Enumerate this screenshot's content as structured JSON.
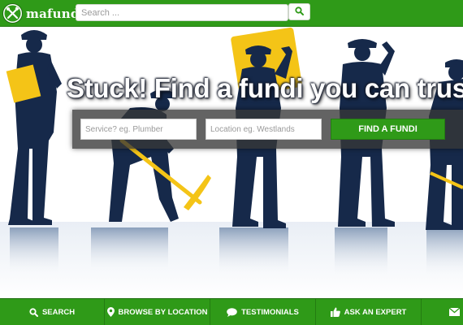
{
  "header": {
    "logo_text": "mafundi",
    "logo_icon": "crossed-tools-icon",
    "search_placeholder": "Search ...",
    "search_button_icon": "search-icon"
  },
  "hero": {
    "headline": "Stuck! Find a fundi you can trust",
    "service_placeholder": "Service? eg. Plumber",
    "location_placeholder": "Location eg. Westlands",
    "find_button_label": "FIND A FUNDI"
  },
  "bottom_nav": {
    "items": [
      {
        "label": "SEARCH",
        "icon": "search-icon"
      },
      {
        "label": "BROWSE BY LOCATION",
        "icon": "map-pin-icon"
      },
      {
        "label": "TESTIMONIALS",
        "icon": "chat-bubble-icon"
      },
      {
        "label": "ASK AN EXPERT",
        "icon": "thumbs-up-icon"
      },
      {
        "label": "",
        "icon": "envelope-icon"
      }
    ]
  },
  "colors": {
    "brand_green": "#2f9a18",
    "worker_navy": "#16294a",
    "accent_yellow": "#f4c417"
  }
}
